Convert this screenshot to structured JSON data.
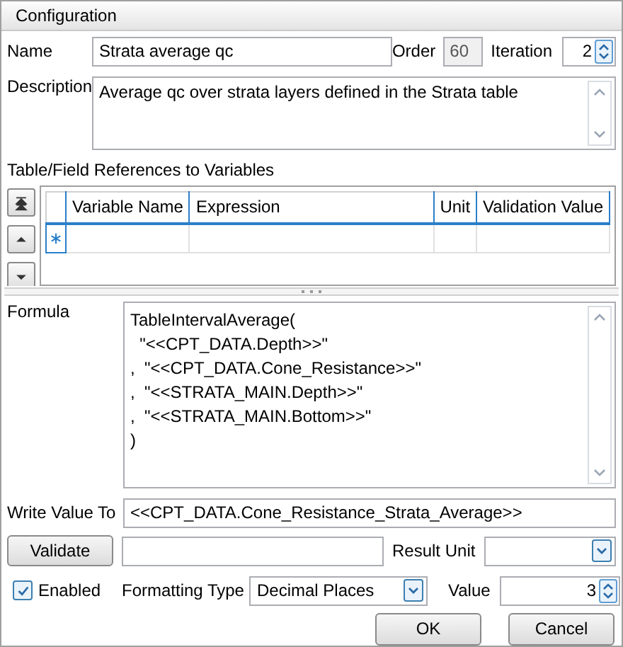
{
  "window": {
    "title": "Configuration"
  },
  "name": {
    "label": "Name",
    "value": "Strata average qc"
  },
  "order": {
    "label": "Order",
    "value": "60",
    "disabled": true
  },
  "iteration": {
    "label": "Iteration",
    "value": "2"
  },
  "description": {
    "label": "Description",
    "value": "Average qc over strata layers defined in the Strata table"
  },
  "references": {
    "label": "Table/Field References to Variables",
    "columns": [
      "Variable Name",
      "Expression",
      "Unit",
      "Validation Value"
    ]
  },
  "formula": {
    "label": "Formula",
    "lines": [
      "TableIntervalAverage(",
      "  \"<<CPT_DATA.Depth>>\"",
      ",  \"<<CPT_DATA.Cone_Resistance>>\"",
      ",  \"<<STRATA_MAIN.Depth>>\"",
      ",  \"<<STRATA_MAIN.Bottom>>\"",
      ")"
    ]
  },
  "write_value_to": {
    "label": "Write Value To",
    "value": "<<CPT_DATA.Cone_Resistance_Strata_Average>>"
  },
  "validate": {
    "button": "Validate",
    "result_unit_label": "Result Unit"
  },
  "enabled": {
    "label": "Enabled",
    "checked": true
  },
  "formatting_type": {
    "label": "Formatting Type",
    "value": "Decimal Places"
  },
  "value": {
    "label": "Value",
    "value": "3"
  },
  "buttons": [
    "OK",
    "Cancel"
  ]
}
